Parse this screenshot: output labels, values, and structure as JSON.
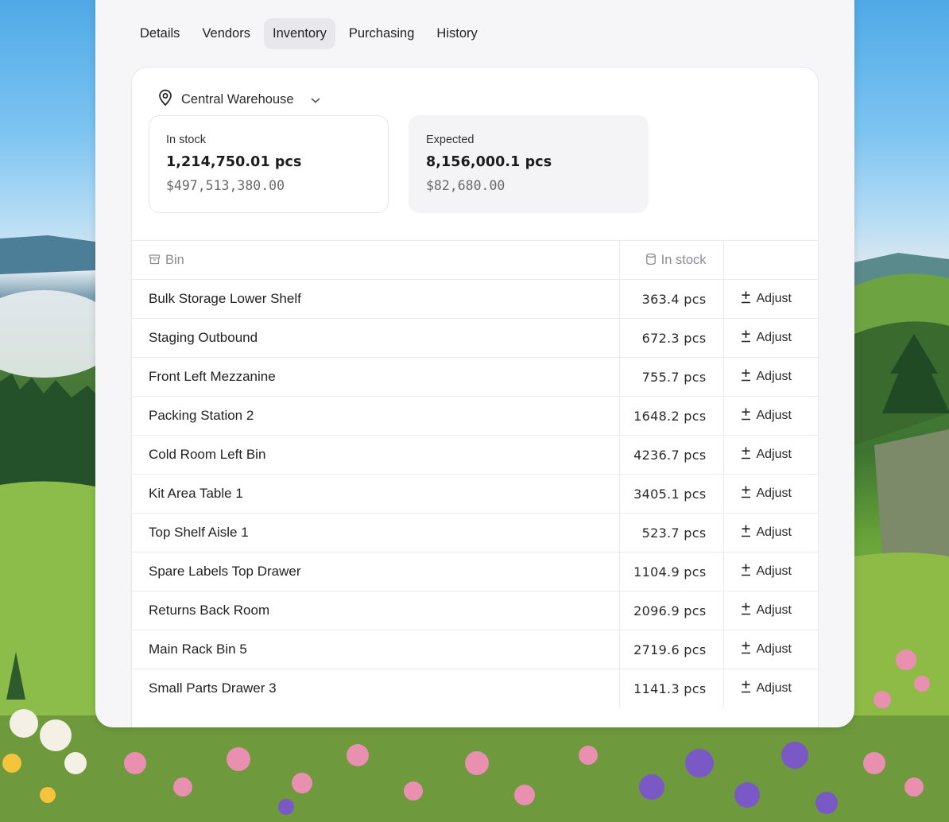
{
  "tabs": [
    {
      "label": "Details",
      "active": false
    },
    {
      "label": "Vendors",
      "active": false
    },
    {
      "label": "Inventory",
      "active": true
    },
    {
      "label": "Purchasing",
      "active": false
    },
    {
      "label": "History",
      "active": false
    }
  ],
  "location": {
    "name": "Central Warehouse",
    "icon": "map-pin-icon"
  },
  "stats": {
    "in_stock": {
      "label": "In stock",
      "quantity": "1,214,750.01 pcs",
      "value": "$497,513,380.00"
    },
    "expected": {
      "label": "Expected",
      "quantity": "8,156,000.1 pcs",
      "value": "$82,680.00"
    }
  },
  "table": {
    "headers": {
      "bin": "Bin",
      "in_stock": "In stock"
    },
    "action_label": "Adjust",
    "rows": [
      {
        "bin": "Bulk Storage Lower Shelf",
        "in_stock": "363.4 pcs"
      },
      {
        "bin": "Staging Outbound",
        "in_stock": "672.3 pcs"
      },
      {
        "bin": "Front Left Mezzanine",
        "in_stock": "755.7 pcs"
      },
      {
        "bin": "Packing Station 2",
        "in_stock": "1648.2 pcs"
      },
      {
        "bin": "Cold Room Left Bin",
        "in_stock": "4236.7 pcs"
      },
      {
        "bin": "Kit Area Table 1",
        "in_stock": "3405.1 pcs"
      },
      {
        "bin": "Top Shelf Aisle 1",
        "in_stock": "523.7 pcs"
      },
      {
        "bin": "Spare Labels Top Drawer",
        "in_stock": "1104.9 pcs"
      },
      {
        "bin": "Returns Back Room",
        "in_stock": "2096.9 pcs"
      },
      {
        "bin": "Main Rack Bin 5",
        "in_stock": "2719.6 pcs"
      },
      {
        "bin": "Small Parts Drawer 3",
        "in_stock": "1141.3 pcs"
      }
    ]
  },
  "colors": {
    "panel_bg": "#f6f5f8",
    "active_tab_bg": "#e8e7ec",
    "card_bg": "#ffffff"
  }
}
